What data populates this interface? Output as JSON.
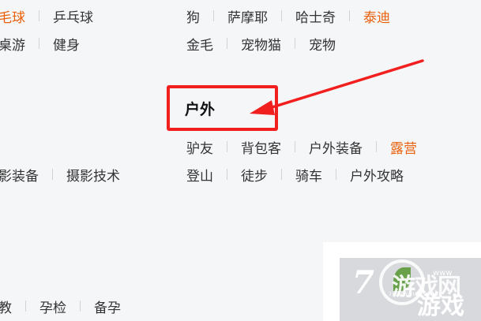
{
  "left_col": {
    "row1": [
      "毛球",
      "乒乓球"
    ],
    "row2": [
      "桌游",
      "健身"
    ],
    "row3": [
      "影装备",
      "摄影技术"
    ],
    "row4": [
      "教",
      "孕检",
      "备孕"
    ]
  },
  "pets": {
    "row1": [
      "狗",
      "萨摩耶",
      "哈士奇",
      "泰迪"
    ],
    "row2": [
      "金毛",
      "宠物猫",
      "宠物"
    ]
  },
  "outdoor": {
    "title": "户外",
    "row1": [
      "驴友",
      "背包客",
      "户外装备",
      "露营"
    ],
    "row2": [
      "登山",
      "徒步",
      "骑车",
      "户外攻略"
    ]
  },
  "accent": {
    "highlight": "#e8600a",
    "annotation": "#f21f1f"
  },
  "watermark": {
    "number": "7",
    "brand": "游戏网",
    "latin": "7HAOYOUXIWANG",
    "game": "游戏",
    "site": "www"
  }
}
